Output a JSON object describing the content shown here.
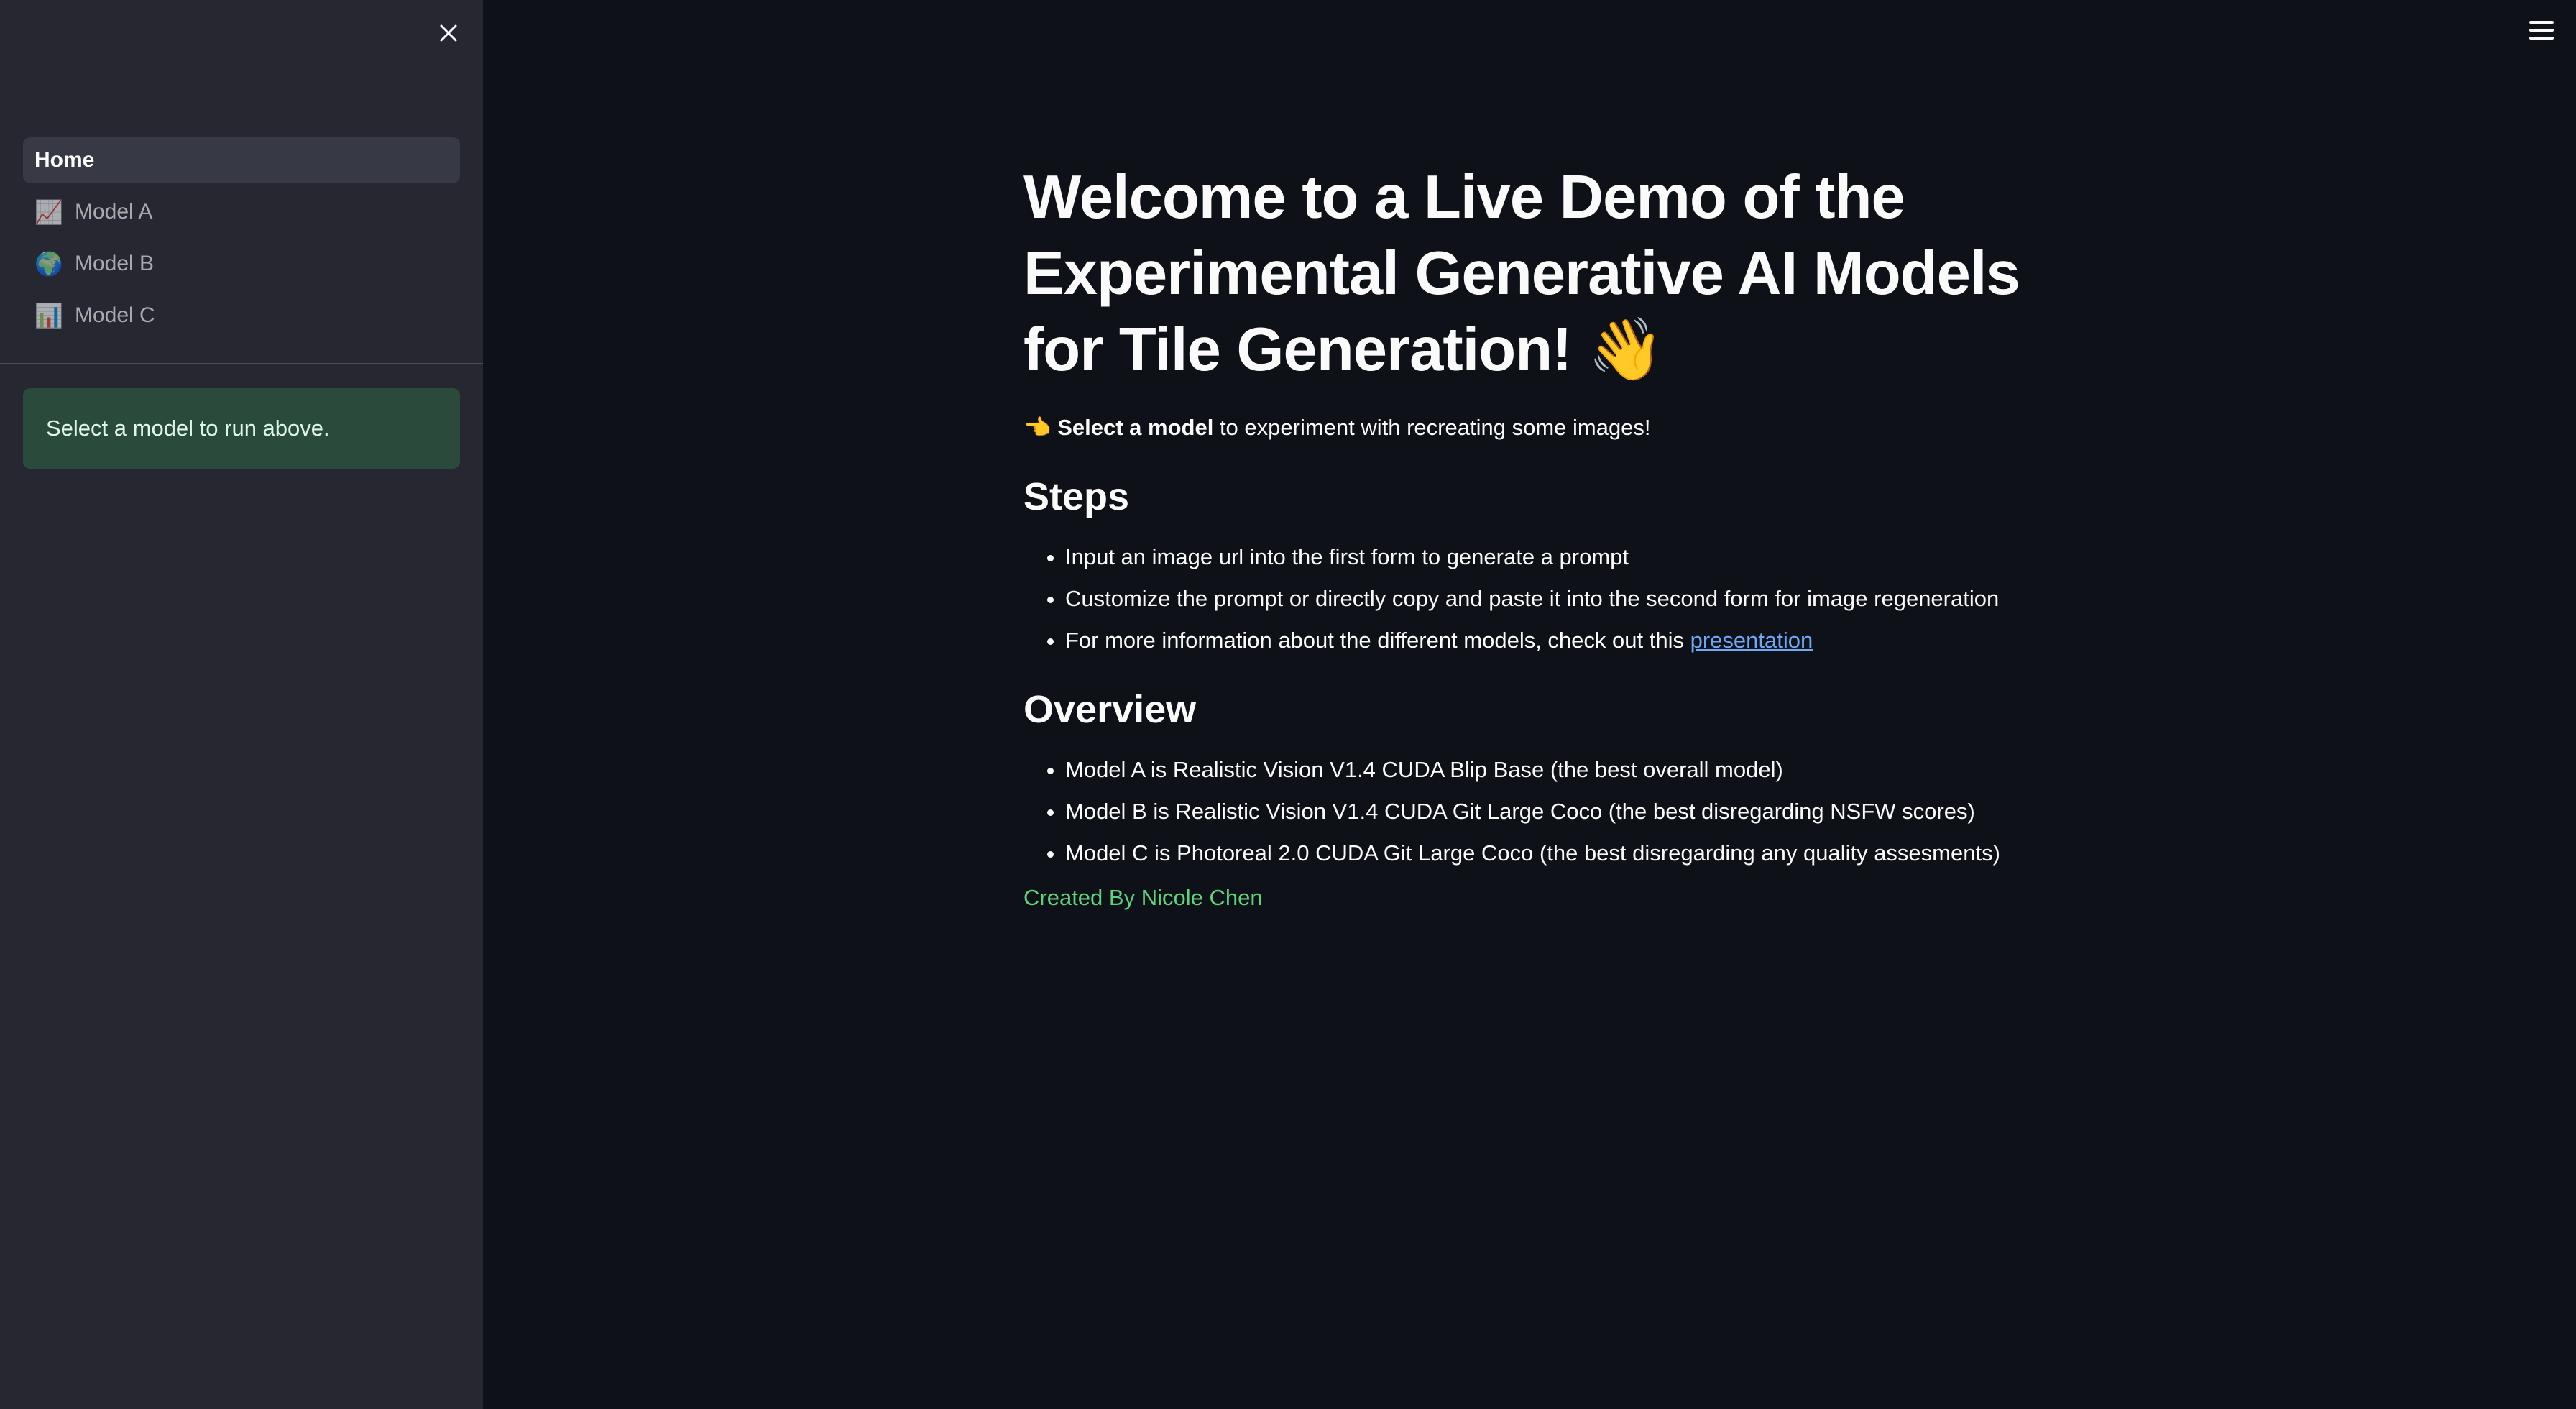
{
  "sidebar": {
    "nav": [
      {
        "label": "Home",
        "icon": "",
        "active": true
      },
      {
        "label": "Model A",
        "icon": "📈",
        "active": false
      },
      {
        "label": "Model B",
        "icon": "🌍",
        "active": false
      },
      {
        "label": "Model C",
        "icon": "📊",
        "active": false
      }
    ],
    "info_text": "Select a model to run above."
  },
  "main": {
    "title_line1": "Welcome to a Live Demo of the",
    "title_line2": "Experimental Generative AI Models",
    "title_line3": "for Tile Generation! 👋",
    "subtitle_icon": "👈",
    "subtitle_bold": "Select a model",
    "subtitle_rest": " to experiment with recreating some images!",
    "steps_heading": "Steps",
    "steps": [
      "Input an image url into the first form to generate a prompt",
      "Customize the prompt or directly copy and paste it into the second form for image regeneration",
      "For more information about the different models, check out this "
    ],
    "steps_link": "presentation",
    "overview_heading": "Overview",
    "overview": [
      "Model A is Realistic Vision V1.4 CUDA Blip Base (the best overall model)",
      "Model B is Realistic Vision V1.4 CUDA Git Large Coco (the best disregarding NSFW scores)",
      "Model C is Photoreal 2.0 CUDA Git Large Coco (the best disregarding any quality assesments)"
    ],
    "credit": "Created By Nicole Chen"
  },
  "colors": {
    "background": "#0e1117",
    "sidebar": "#262730",
    "link": "#6fa8f5",
    "credit": "#5fd27d",
    "info_box": "#2e4a3b"
  },
  "icons": {
    "close": "close-icon",
    "menu": "hamburger-menu-icon"
  }
}
